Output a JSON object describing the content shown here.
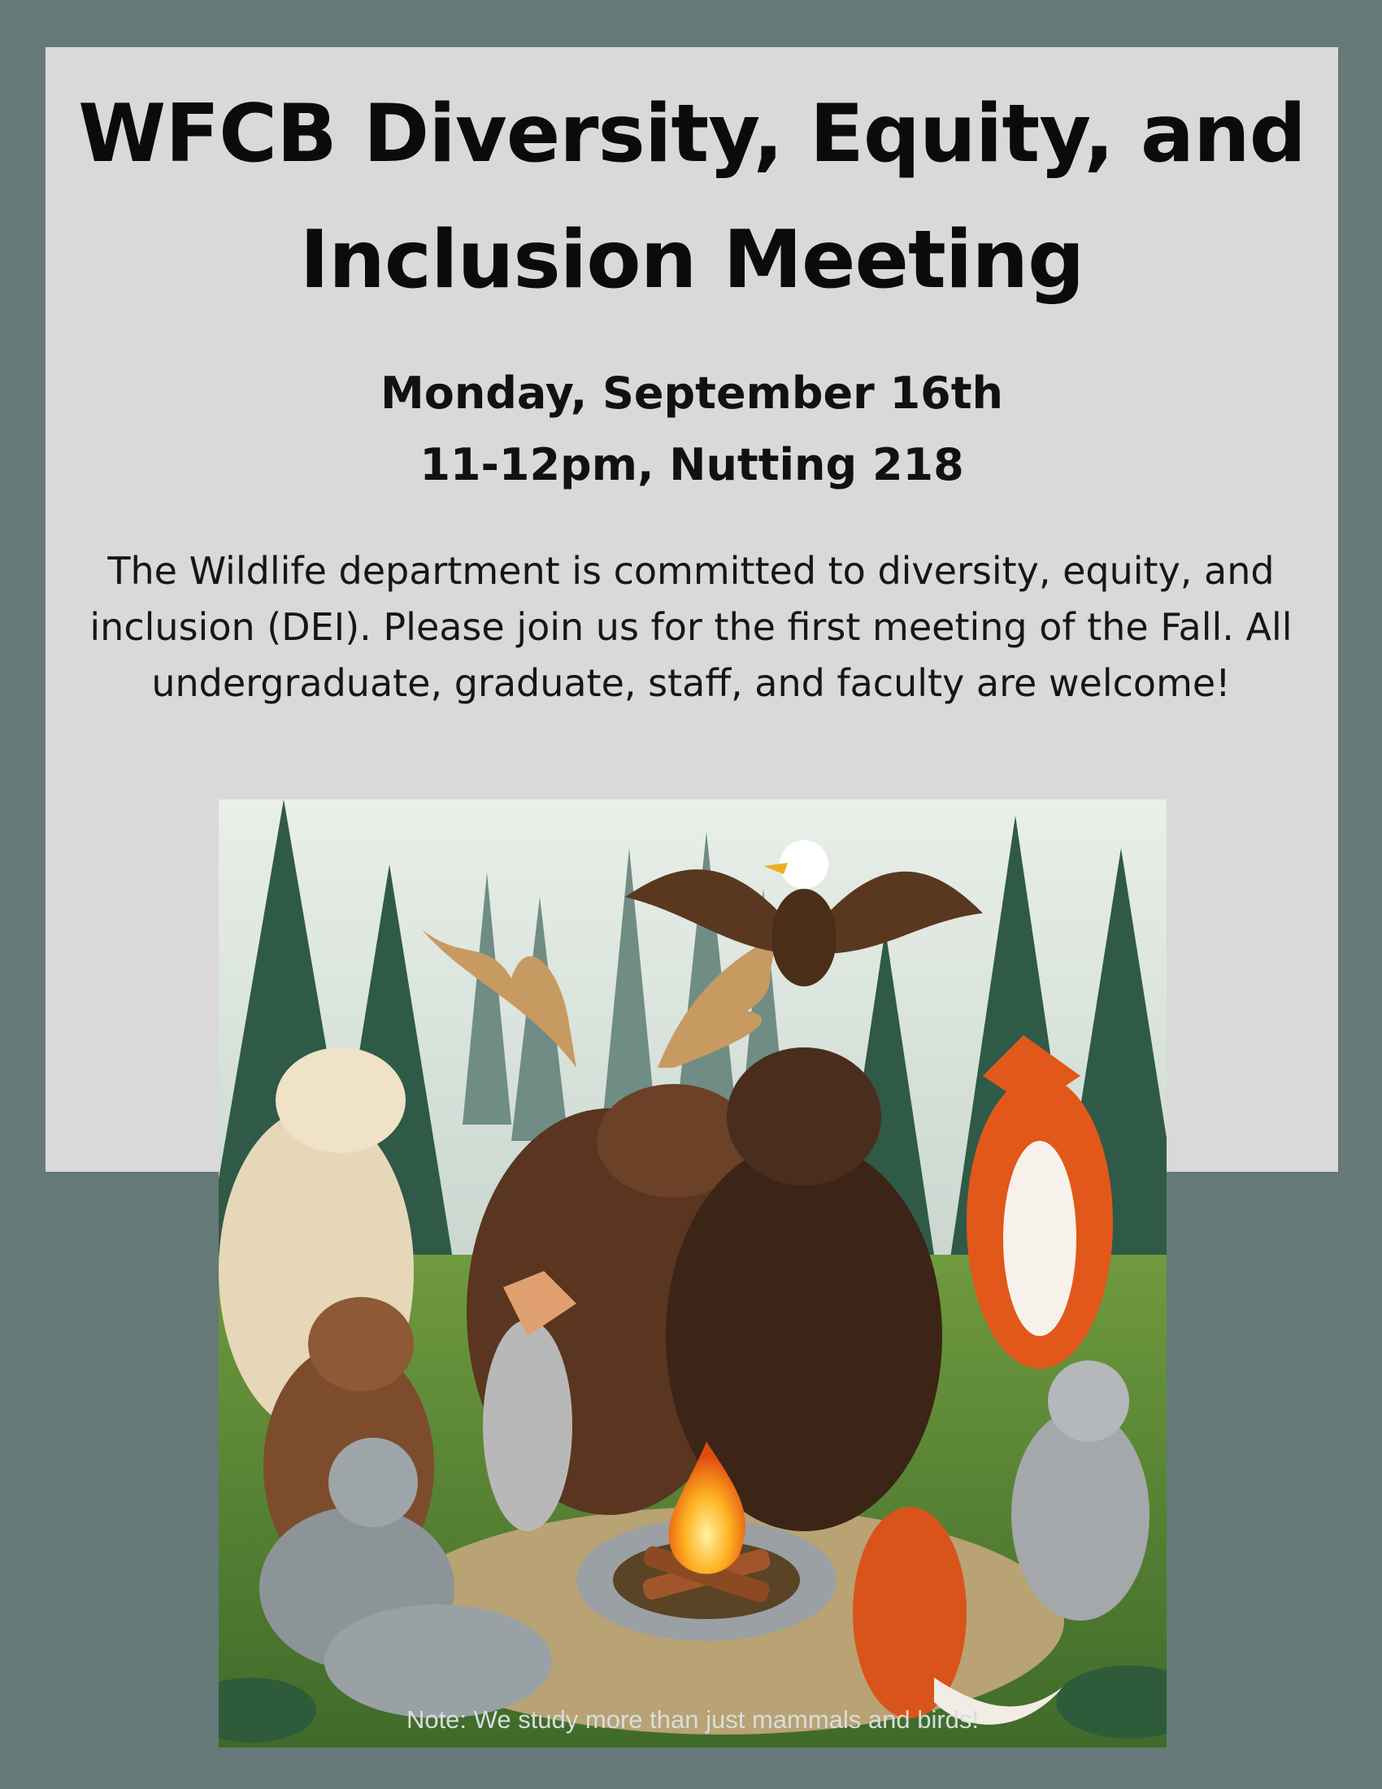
{
  "flyer": {
    "title_line1": "WFCB Diversity, Equity, and",
    "title_line2": "Inclusion Meeting",
    "date": "Monday, September 16th",
    "time_place": "11-12pm, Nutting 218",
    "description": "The Wildlife department is committed to diversity, equity, and inclusion (DEI). Please join us for the first meeting of the Fall. All undergraduate, graduate, staff, and faculty are welcome!",
    "note": "Note: We study more than just mammals and birds!"
  },
  "colors": {
    "background": "#657a78",
    "panel": "#d9d9d9",
    "text": "#0b0b0b"
  }
}
